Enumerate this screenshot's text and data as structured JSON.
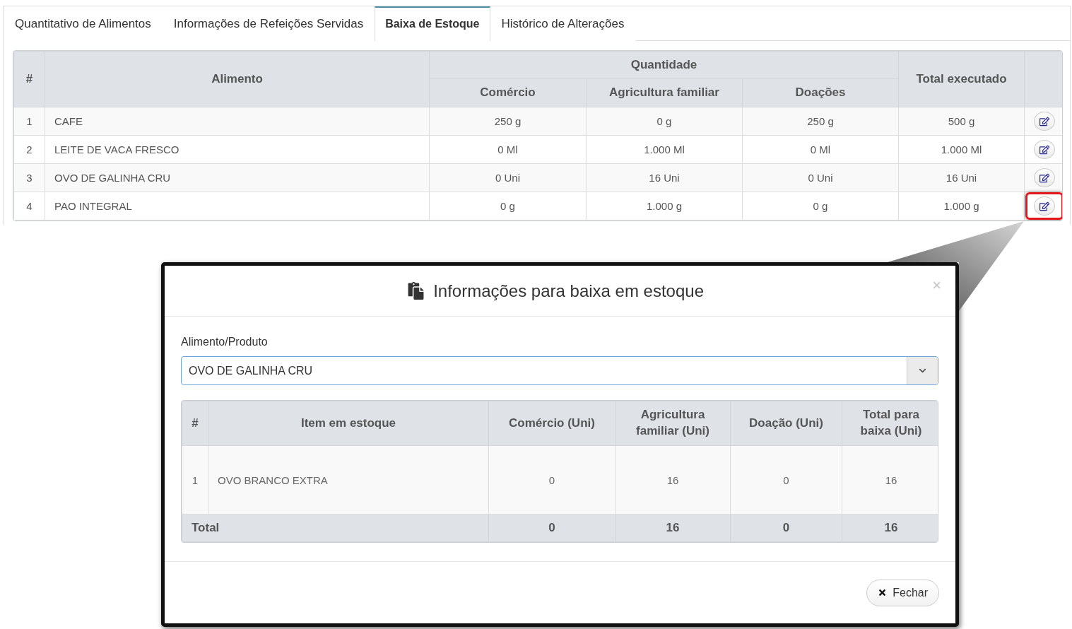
{
  "tabs": [
    {
      "label": "Quantitativo de Alimentos",
      "selected": false
    },
    {
      "label": "Informações de Refeições Servidas",
      "selected": false
    },
    {
      "label": "Baixa de Estoque",
      "selected": true
    },
    {
      "label": "Histórico de Alterações",
      "selected": false
    }
  ],
  "table": {
    "header": {
      "number": "#",
      "food": "Alimento",
      "quantity": "Quantidade",
      "sources": [
        "Comércio",
        "Agricultura familiar",
        "Doações"
      ],
      "total": "Total executado"
    },
    "rows": [
      {
        "number": "1",
        "food": "CAFE",
        "quantities": [
          "250 g",
          "0 g",
          "250 g"
        ],
        "total": "500 g",
        "highlighted": false
      },
      {
        "number": "2",
        "food": "LEITE DE VACA FRESCO",
        "quantities": [
          "0 Ml",
          "1.000 Ml",
          "0 Ml"
        ],
        "total": "1.000 Ml",
        "highlighted": false
      },
      {
        "number": "3",
        "food": "OVO DE GALINHA CRU",
        "quantities": [
          "0 Uni",
          "16 Uni",
          "0 Uni"
        ],
        "total": "16 Uni",
        "highlighted": false
      },
      {
        "number": "4",
        "food": "PAO INTEGRAL",
        "quantities": [
          "0 g",
          "1.000 g",
          "0 g"
        ],
        "total": "1.000 g",
        "highlighted": true
      }
    ]
  },
  "modal": {
    "title": "Informações para baixa em estoque",
    "close": "×",
    "field": {
      "label": "Alimento/Produto",
      "value": "OVO DE GALINHA CRU"
    },
    "table": {
      "columns": [
        "#",
        "Item em estoque",
        "Comércio (Uni)",
        "Agricultura familiar (Uni)",
        "Doação (Uni)",
        "Total para baixa (Uni)"
      ],
      "rows": [
        [
          "1",
          "OVO BRANCO EXTRA",
          "0",
          "16",
          "0",
          "16"
        ]
      ],
      "footer": [
        "Total",
        "0",
        "16",
        "0",
        "16"
      ]
    },
    "buttons": [
      {
        "label": "Fechar",
        "kind": "close"
      }
    ]
  }
}
